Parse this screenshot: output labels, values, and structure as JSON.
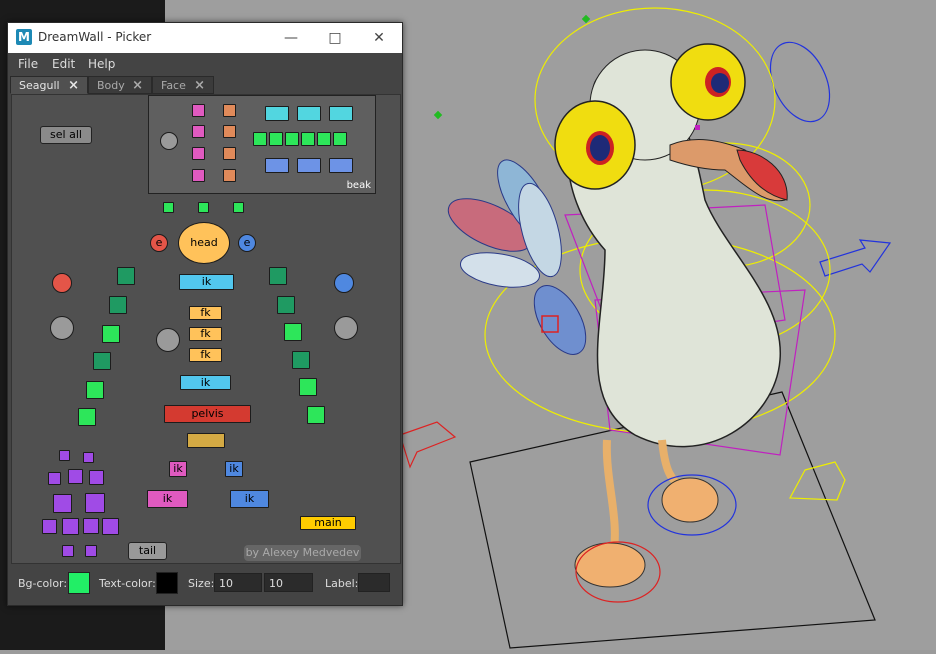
{
  "window": {
    "title": "DreamWall - Picker",
    "minimize_icon": "minimize-icon",
    "maximize_icon": "maximize-icon",
    "close_icon": "close-icon"
  },
  "menu": [
    "File",
    "Edit",
    "Help"
  ],
  "tabs": [
    {
      "label": "Seagull",
      "active": true
    },
    {
      "label": "Body",
      "active": false
    },
    {
      "label": "Face",
      "active": false
    }
  ],
  "picker": {
    "sel_all": "sel all",
    "beak_label": "beak",
    "head": "head",
    "eye_left": "e",
    "eye_right": "e",
    "ik": "ik",
    "fk": "fk",
    "pelvis": "pelvis",
    "tail": "tail",
    "main": "main",
    "credit": "by Alexey Medvedev"
  },
  "bottom": {
    "bg_color_label": "Bg-color:",
    "bg_color": "#22ee66",
    "text_color_label": "Text-color:",
    "text_color": "#000000",
    "size_label": "Size:",
    "size_w": "10",
    "size_h": "10",
    "label_label": "Label:",
    "label_value": ""
  },
  "colors": {
    "green_dark": "#1f9a62",
    "green_light": "#2de65a",
    "pink": "#e05ac0",
    "orange": "#e08a5a",
    "cyan": "#52d6e0",
    "blue": "#6d93e6",
    "yellow": "#ffc25a",
    "red_pelvis": "#d43a30",
    "purple": "#a04be6"
  }
}
